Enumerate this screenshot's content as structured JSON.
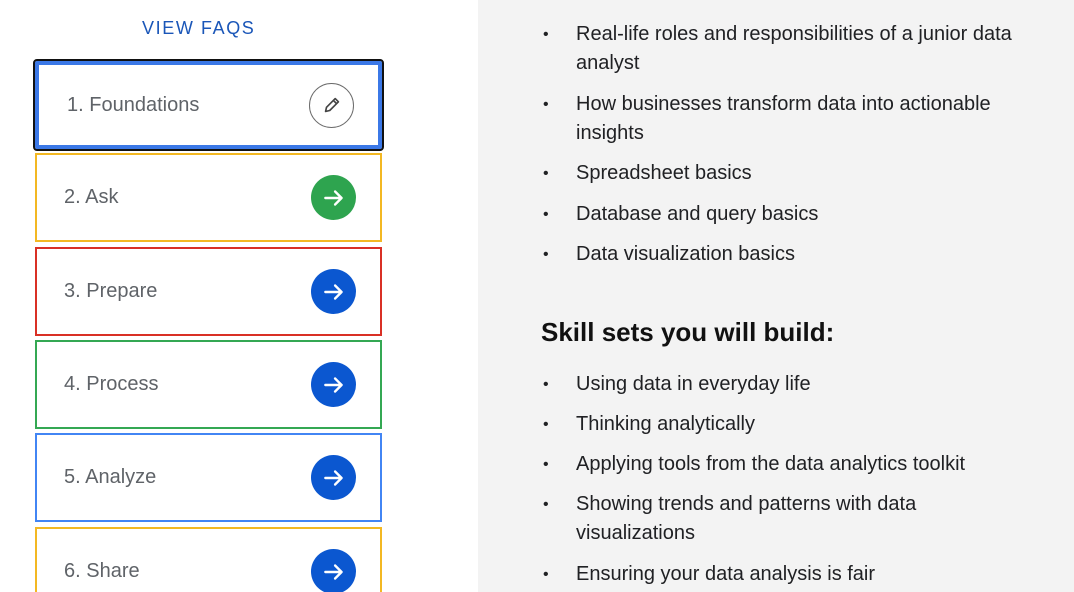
{
  "faqs": {
    "label": "VIEW FAQS"
  },
  "modules": [
    {
      "label": "1. Foundations",
      "icon": "edit-pencil-icon",
      "state": "active"
    },
    {
      "label": "2. Ask",
      "icon": "arrow-right-icon",
      "state": "done",
      "border_color": "#f3b823",
      "icon_color": "#2ea44f"
    },
    {
      "label": "3. Prepare",
      "icon": "arrow-right-icon",
      "state": "todo",
      "border_color": "#d93025",
      "icon_color": "#0b57d0"
    },
    {
      "label": "4. Process",
      "icon": "arrow-right-icon",
      "state": "todo",
      "border_color": "#34a853",
      "icon_color": "#0b57d0"
    },
    {
      "label": "5. Analyze",
      "icon": "arrow-right-icon",
      "state": "todo",
      "border_color": "#4285f4",
      "icon_color": "#0b57d0"
    },
    {
      "label": "6. Share",
      "icon": "arrow-right-icon",
      "state": "todo",
      "border_color": "#f3b823",
      "icon_color": "#0b57d0"
    }
  ],
  "topics": [
    "Real-life roles and responsibilities of a junior data analyst",
    "How businesses transform data into actionable insights",
    "Spreadsheet basics",
    "Database and query basics",
    "Data visualization basics"
  ],
  "skills_heading": "Skill sets you will build:",
  "skills": [
    "Using data in everyday life",
    "Thinking analytically",
    "Applying tools from the data analytics toolkit",
    "Showing trends and patterns with data visualizations",
    "Ensuring your data analysis is fair"
  ],
  "colors": {
    "accent_blue": "#1a56b8",
    "active_border": "#3b78e7",
    "right_background": "#f3f3f3"
  }
}
